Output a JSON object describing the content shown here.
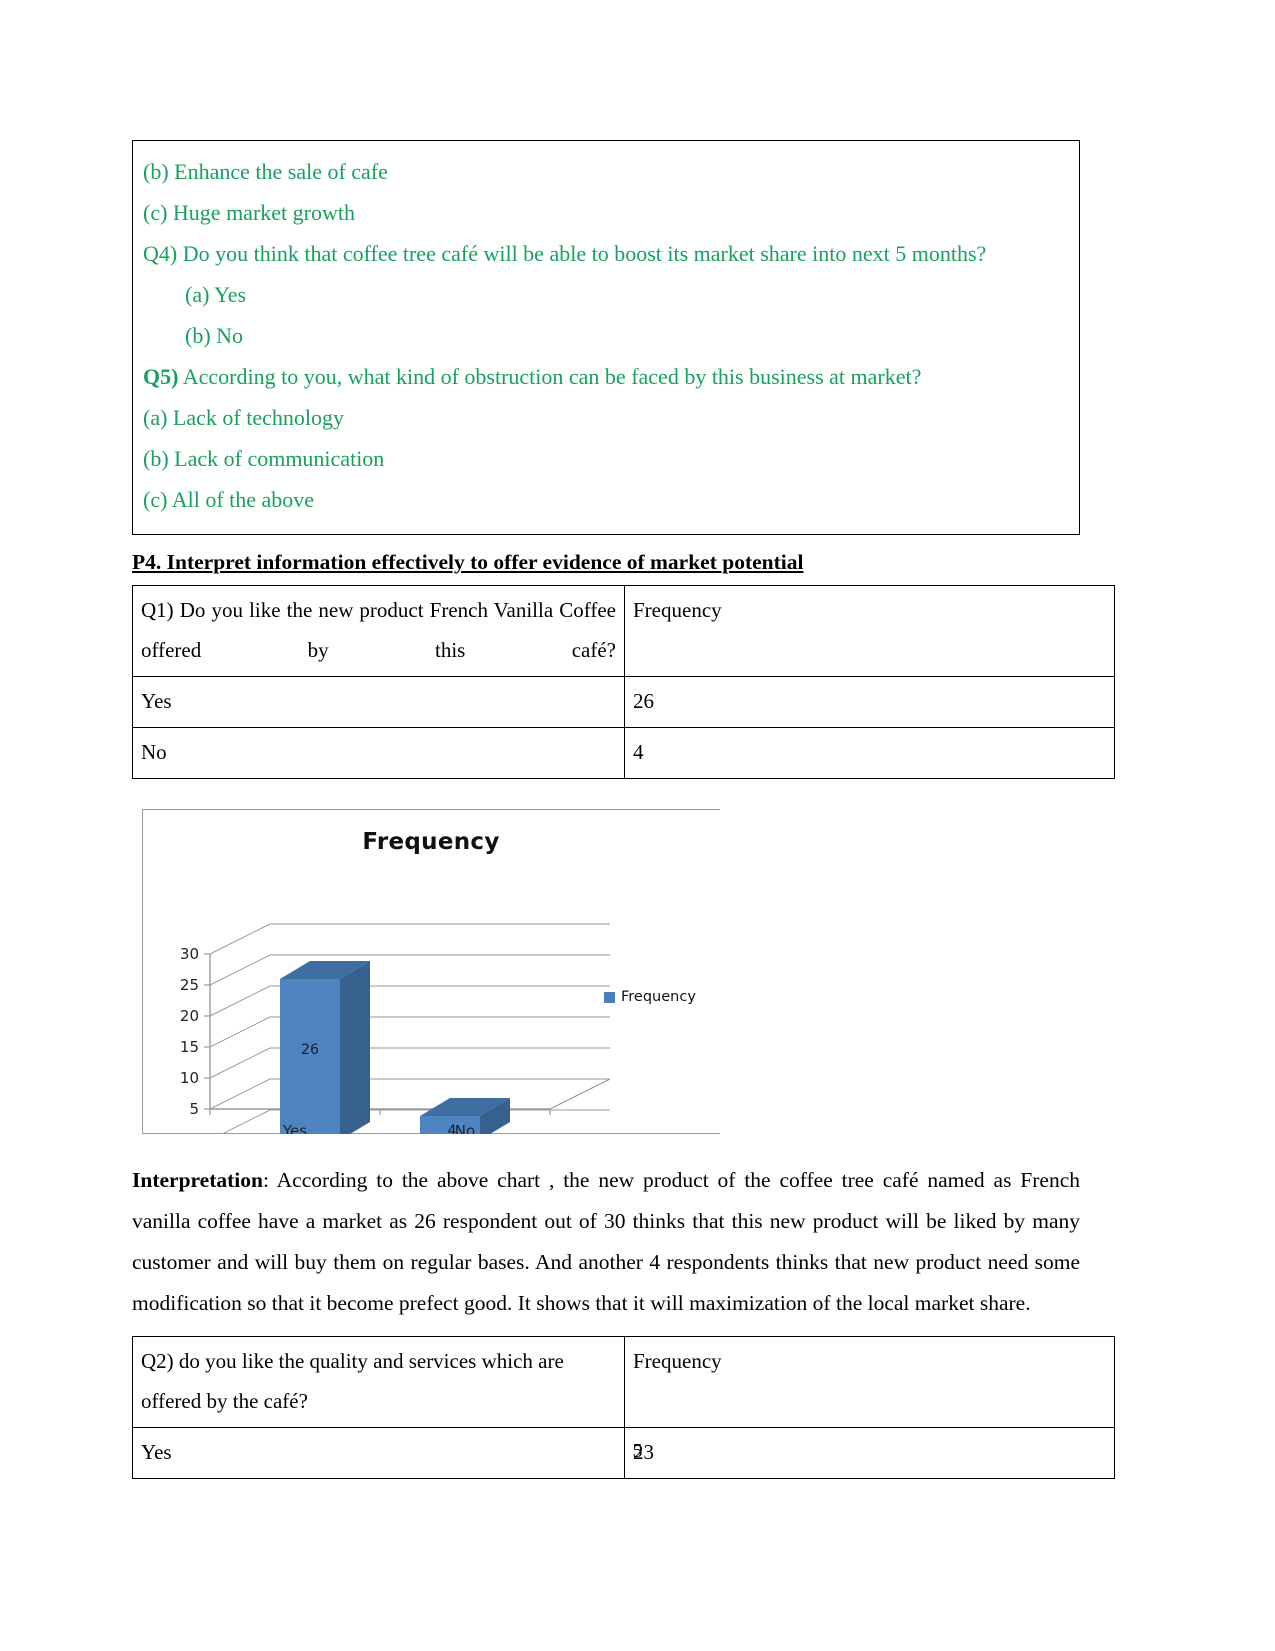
{
  "document": {
    "page_number": "5"
  },
  "green_block": {
    "lines": [
      {
        "text": "(b) Enhance the sale of cafe",
        "indent": false,
        "bold_prefix": ""
      },
      {
        "text": "(c) Huge market growth",
        "indent": false,
        "bold_prefix": ""
      },
      {
        "text": "Q4) Do you think that coffee tree café will be able to boost its market share into next 5 months?",
        "indent": false,
        "bold_prefix": ""
      },
      {
        "text": "(a)  Yes",
        "indent": true,
        "bold_prefix": ""
      },
      {
        "text": "(b)  No",
        "indent": true,
        "bold_prefix": ""
      },
      {
        "text": " According to you, what kind of obstruction can be faced by this business at market?",
        "indent": false,
        "bold_prefix": "Q5)"
      },
      {
        "text": "(a) Lack of technology",
        "indent": false,
        "bold_prefix": ""
      },
      {
        "text": "(b) Lack of communication",
        "indent": false,
        "bold_prefix": ""
      },
      {
        "text": "(c) All of the above",
        "indent": false,
        "bold_prefix": ""
      }
    ],
    "text_color": "#17a05e"
  },
  "section_heading": "P4. Interpret information effectively to offer evidence of market potential",
  "table_q1": {
    "header": {
      "question": "Q1) Do you like the new product French Vanilla Coffee offered by this café?",
      "frequency": "Frequency"
    },
    "rows": [
      {
        "label": "Yes",
        "value": "26"
      },
      {
        "label": "No",
        "value": "4"
      }
    ]
  },
  "chart_data": {
    "type": "bar",
    "title": "Frequency",
    "categories": [
      "Yes",
      "No"
    ],
    "values": [
      26,
      4
    ],
    "series": [
      {
        "name": "Frequency",
        "values": [
          26,
          4
        ]
      }
    ],
    "data_labels": [
      "26",
      "4"
    ],
    "xlabel": "",
    "ylabel": "",
    "ylim": [
      0,
      30
    ],
    "yticks": [
      "0",
      "5",
      "10",
      "15",
      "20",
      "25",
      "30"
    ],
    "legend": [
      "Frequency"
    ],
    "legend_position": "right",
    "grid": true,
    "three_d": true,
    "series_color": "#4a7ebb"
  },
  "interpretation": {
    "label": "Interpretation",
    "text": ": According to the above chart , the new product of the coffee tree café named as French vanilla coffee have a market as 26 respondent out of 30 thinks that this new product will be liked by many customer and will buy them on regular bases. And another 4 respondents thinks that new product need some modification so that it become prefect good. It shows that it will maximization of the  local market share."
  },
  "table_q2": {
    "header": {
      "question": "Q2) do you like the quality and services which are offered by the café?",
      "frequency": "Frequency"
    },
    "rows": [
      {
        "label": "Yes",
        "value": "23"
      }
    ]
  }
}
